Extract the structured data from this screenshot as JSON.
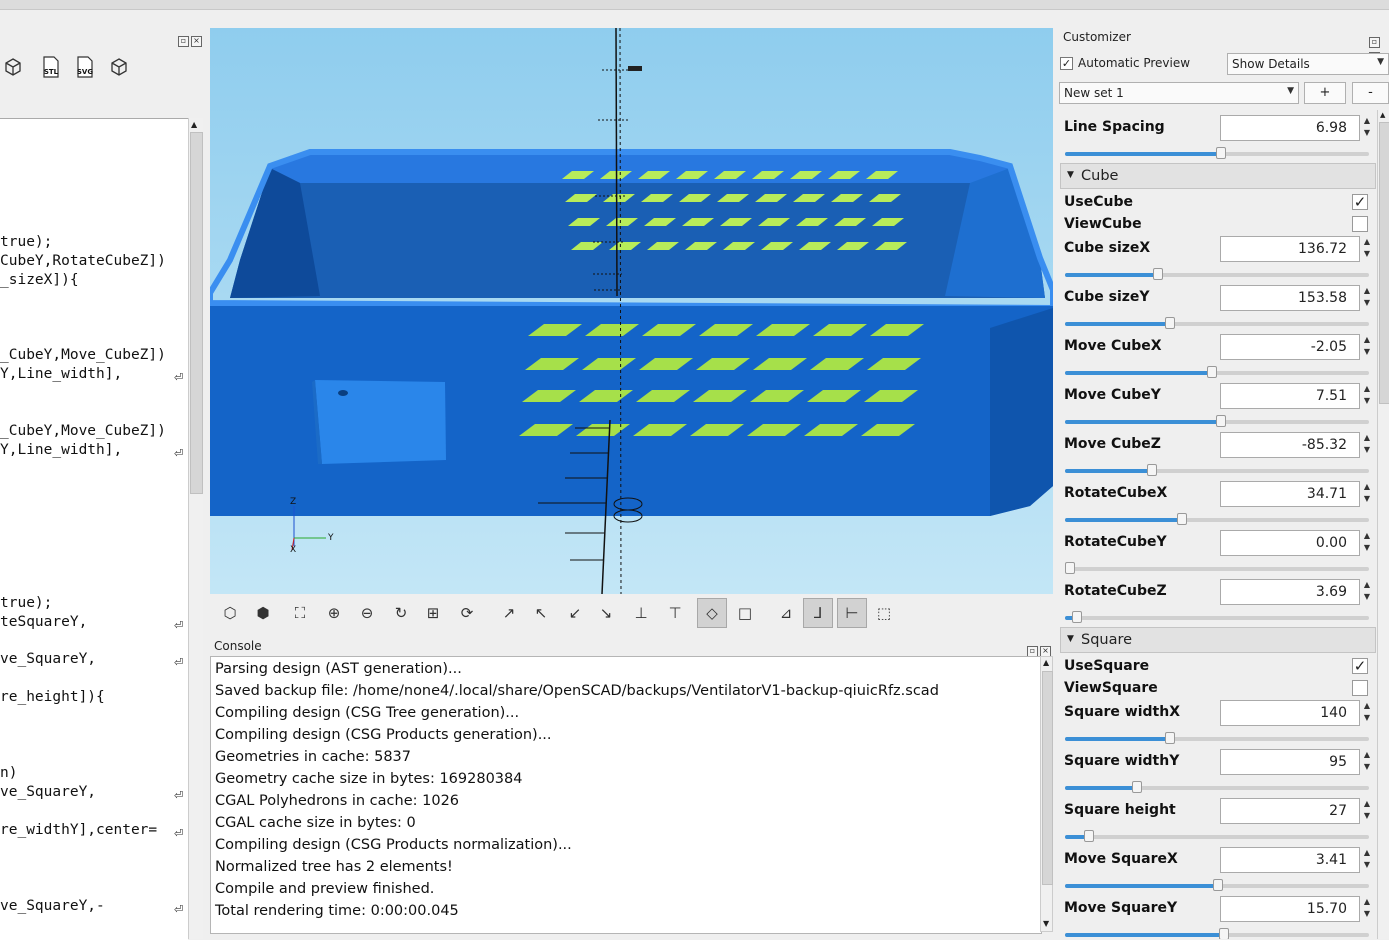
{
  "editor": {
    "toolbar_icons": [
      "render-icon",
      "render-cgal-icon",
      "export-stl-icon",
      "export-svg-icon",
      "cube-icon"
    ],
    "stl_label": "STL",
    "svg_label": "SVG",
    "lines": [
      {
        "text": "true);",
        "wrap": false
      },
      {
        "text": "CubeY,RotateCubeZ])",
        "wrap": false
      },
      {
        "text": "_sizeX]){",
        "wrap": false
      },
      {
        "text": "_CubeY,Move_CubeZ])",
        "wrap": false
      },
      {
        "text": "Y,Line_width],",
        "wrap": true
      },
      {
        "text": "_CubeY,Move_CubeZ])",
        "wrap": false
      },
      {
        "text": "Y,Line_width],",
        "wrap": true
      },
      {
        "text": "true);",
        "wrap": false
      },
      {
        "text": "teSquareY,",
        "wrap": true
      },
      {
        "text": "ve_SquareY,",
        "wrap": true
      },
      {
        "text": "re_height]){",
        "wrap": false
      },
      {
        "text": "n)",
        "wrap": false
      },
      {
        "text": "ve_SquareY,",
        "wrap": true
      },
      {
        "text": "re_widthY],center=",
        "wrap": true
      },
      {
        "text": "ve_SquareY,-",
        "wrap": true
      }
    ]
  },
  "viewport": {
    "axis_labels": {
      "z": "Z",
      "y": "Y",
      "x": "X"
    },
    "box_color": "#1e6fd0",
    "slot_color": "#a6e04a",
    "background": "#8fcdee"
  },
  "view_toolbar": {
    "buttons": [
      "preview-icon",
      "render-icon",
      "view-all-icon",
      "zoom-in-icon",
      "zoom-out-icon",
      "reset-view-icon",
      "view-perspective-icon",
      "view-orthogonal-icon",
      "view-right-icon",
      "view-top-icon",
      "view-bottom-icon",
      "view-left-icon",
      "view-front-icon",
      "view-back-icon",
      "view-diagonal-icon",
      "view-center-icon",
      "show-edges-icon",
      "show-axes-icon",
      "show-scale-icon",
      "crosshairs-icon"
    ]
  },
  "console": {
    "title": "Console",
    "lines": [
      "Parsing design (AST generation)...",
      "Saved backup file: /home/none4/.local/share/OpenSCAD/backups/VentilatorV1-backup-qiuicRfz.scad",
      "Compiling design (CSG Tree generation)...",
      "Compiling design (CSG Products generation)...",
      "Geometries in cache: 5837",
      "Geometry cache size in bytes: 169280384",
      "CGAL Polyhedrons in cache: 1026",
      "CGAL cache size in bytes: 0",
      "Compiling design (CSG Products normalization)...",
      "Normalized tree has 2 elements!",
      "Compile and preview finished.",
      "Total rendering time: 0:00:00.045"
    ]
  },
  "customizer": {
    "title": "Customizer",
    "auto_preview_label": "Automatic Preview",
    "auto_preview_checked": true,
    "details_value": "Show Details",
    "preset_value": "New set 1",
    "add_label": "+",
    "remove_label": "-",
    "line_spacing": {
      "label": "Line Spacing",
      "value": "6.98",
      "fraction": 0.52
    },
    "groups": [
      {
        "name": "Cube",
        "checks": [
          {
            "label": "UseCube",
            "checked": true
          },
          {
            "label": "ViewCube",
            "checked": false
          }
        ],
        "params": [
          {
            "label": "Cube sizeX",
            "value": "136.72",
            "fraction": 0.31
          },
          {
            "label": "Cube sizeY",
            "value": "153.58",
            "fraction": 0.35
          },
          {
            "label": "Move CubeX",
            "value": "-2.05",
            "fraction": 0.49
          },
          {
            "label": "Move CubeY",
            "value": "7.51",
            "fraction": 0.52
          },
          {
            "label": "Move CubeZ",
            "value": "-85.32",
            "fraction": 0.29
          },
          {
            "label": "RotateCubeX",
            "value": "34.71",
            "fraction": 0.39
          },
          {
            "label": "RotateCubeY",
            "value": "0.00",
            "fraction": 0.0
          },
          {
            "label": "RotateCubeZ",
            "value": "3.69",
            "fraction": 0.04
          }
        ]
      },
      {
        "name": "Square",
        "checks": [
          {
            "label": "UseSquare",
            "checked": true
          },
          {
            "label": "ViewSquare",
            "checked": false
          }
        ],
        "params": [
          {
            "label": "Square widthX",
            "value": "140",
            "fraction": 0.35
          },
          {
            "label": "Square widthY",
            "value": "95",
            "fraction": 0.24
          },
          {
            "label": "Square height",
            "value": "27",
            "fraction": 0.08
          },
          {
            "label": "Move SquareX",
            "value": "3.41",
            "fraction": 0.51
          },
          {
            "label": "Move SquareY",
            "value": "15.70",
            "fraction": 0.53
          }
        ]
      }
    ]
  }
}
